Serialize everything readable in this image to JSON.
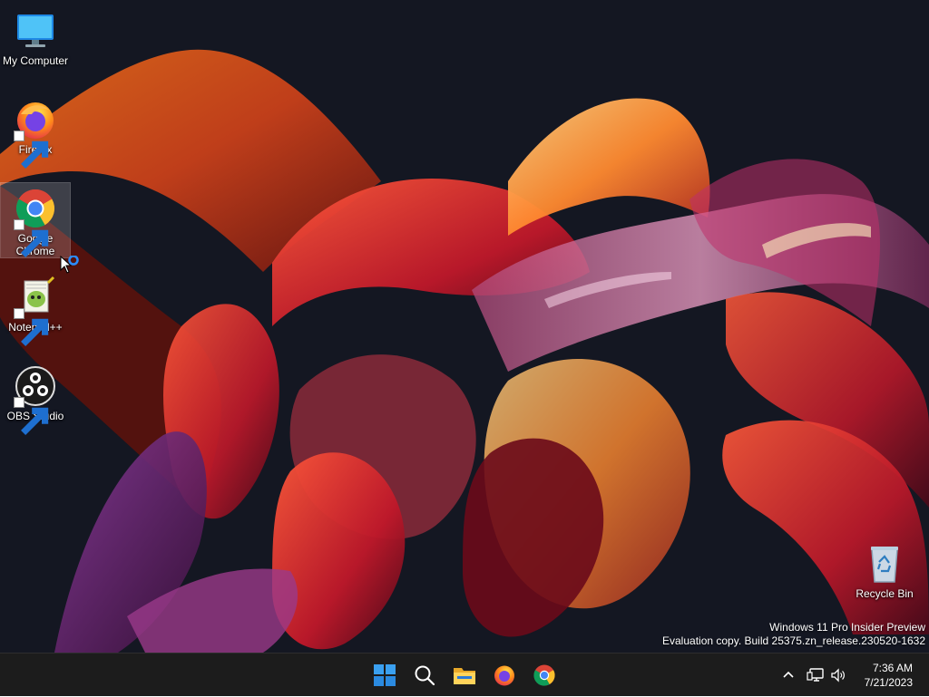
{
  "desktop": {
    "icons": [
      {
        "label": "My Computer",
        "icon": "monitor-icon"
      },
      {
        "label": "Firefox",
        "icon": "firefox-icon"
      },
      {
        "label": "Google Chrome",
        "icon": "chrome-icon"
      },
      {
        "label": "Notepad++",
        "icon": "notepadpp-icon"
      },
      {
        "label": "OBS Studio",
        "icon": "obs-icon"
      },
      {
        "label": "Recycle Bin",
        "icon": "recycle-bin-icon"
      }
    ],
    "watermark": {
      "line1": "Windows 11 Pro Insider Preview",
      "line2": "Evaluation copy. Build 25375.zn_release.230520-1632"
    }
  },
  "taskbar": {
    "pinned": [
      {
        "name": "start",
        "icon": "windows-start-icon"
      },
      {
        "name": "search",
        "icon": "search-icon"
      },
      {
        "name": "file-explorer",
        "icon": "folder-icon"
      },
      {
        "name": "firefox",
        "icon": "firefox-icon"
      },
      {
        "name": "chrome",
        "icon": "chrome-icon"
      }
    ],
    "tray": {
      "icons": [
        "chevron-up-icon",
        "network-icon",
        "volume-icon"
      ]
    },
    "clock": {
      "time": "7:36 AM",
      "date": "7/21/2023"
    }
  },
  "colors": {
    "taskbar_bg": "#1c1c1c",
    "desktop_bg": "#121520",
    "accent_blue": "#0078d4"
  }
}
